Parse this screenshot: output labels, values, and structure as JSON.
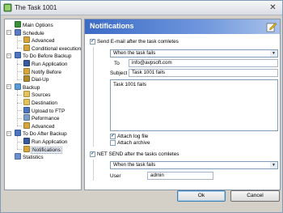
{
  "window": {
    "title": "The Task 1001"
  },
  "tree": {
    "items": [
      {
        "label": "Main Options",
        "icon": "options-icon",
        "color": "#3a8f3a"
      },
      {
        "label": "Schedule",
        "icon": "calendar-icon",
        "color": "#5b7cc4"
      },
      {
        "label": "Advanced",
        "icon": "check-icon",
        "color": "#d8a53a"
      },
      {
        "label": "Conditional execution",
        "icon": "check-icon",
        "color": "#d8a53a"
      },
      {
        "label": "To Do Before Backup",
        "icon": "folder-icon",
        "color": "#4a76c1"
      },
      {
        "label": "Run Application",
        "icon": "app-icon",
        "color": "#355a9e"
      },
      {
        "label": "Notify Before",
        "icon": "notify-icon",
        "color": "#d8a53a"
      },
      {
        "label": "Dial-Up",
        "icon": "phone-icon",
        "color": "#b0892d"
      },
      {
        "label": "Backup",
        "icon": "backup-icon",
        "color": "#5c9ad8"
      },
      {
        "label": "Sources",
        "icon": "folder-icon",
        "color": "#e5c15a"
      },
      {
        "label": "Destination",
        "icon": "folder-icon",
        "color": "#e5c15a"
      },
      {
        "label": "Upload to FTP",
        "icon": "ftp-icon",
        "color": "#4a76c1"
      },
      {
        "label": "Peformance",
        "icon": "performance-icon",
        "color": "#7a9cc8"
      },
      {
        "label": "Advanced",
        "icon": "check-icon",
        "color": "#d8a53a"
      },
      {
        "label": "To Do After Backup",
        "icon": "folder-icon",
        "color": "#4a76c1"
      },
      {
        "label": "Run Application",
        "icon": "app-icon",
        "color": "#355a9e"
      },
      {
        "label": "Notifications",
        "icon": "notify-icon",
        "color": "#d8a53a"
      },
      {
        "label": "Statistics",
        "icon": "statistics-icon",
        "color": "#6b8fd0"
      }
    ]
  },
  "panel": {
    "title": "Notifications",
    "email": {
      "checkbox_label": "Send E-mail after the task comletes",
      "checked": true,
      "when": "When the task fails",
      "to_label": "To",
      "to_value": "info@avpsoft.com",
      "subject_label": "Subject",
      "subject_value": "Task 1001 fails",
      "body": "Task 1001 fails",
      "attach_log_label": "Attach log file",
      "attach_log_checked": true,
      "attach_archive_label": "Attach archive",
      "attach_archive_checked": false
    },
    "netsend": {
      "checkbox_label": "NET SEND after the tasks comletes",
      "checked": true,
      "when": "When the task fails",
      "user_label": "User",
      "user_value": "admin"
    }
  },
  "buttons": {
    "ok": "Ok",
    "cancel": "Cancel"
  }
}
